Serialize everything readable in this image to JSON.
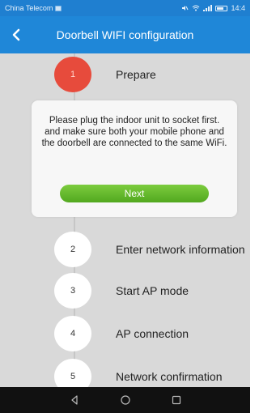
{
  "status_bar": {
    "carrier": "China Telecom",
    "time": "14:4",
    "icons": [
      "sim-icon",
      "mute-icon",
      "wifi-icon",
      "signal-icon",
      "battery-icon"
    ]
  },
  "header": {
    "title": "Doorbell WIFI configuration",
    "back_icon": "back-arrow-icon",
    "background": "#1f87d8"
  },
  "steps": [
    {
      "number": "1",
      "label": "Prepare",
      "active": true
    },
    {
      "number": "2",
      "label": "Enter network information",
      "active": false
    },
    {
      "number": "3",
      "label": "Start AP mode",
      "active": false
    },
    {
      "number": "4",
      "label": "AP connection",
      "active": false
    },
    {
      "number": "5",
      "label": "Network confirmation",
      "active": false
    }
  ],
  "prepare_card": {
    "message": "Please plug the indoor unit to socket first.\nand make sure both your mobile phone and the doorbell are connected to the same WiFi.",
    "next_label": "Next"
  },
  "nav_bar": {
    "icons": [
      "back-triangle-icon",
      "home-circle-icon",
      "recents-square-icon"
    ]
  },
  "colors": {
    "active_step": "#e74b3c",
    "next_button": "#5cb52a",
    "content_background": "#d9d9d9"
  }
}
